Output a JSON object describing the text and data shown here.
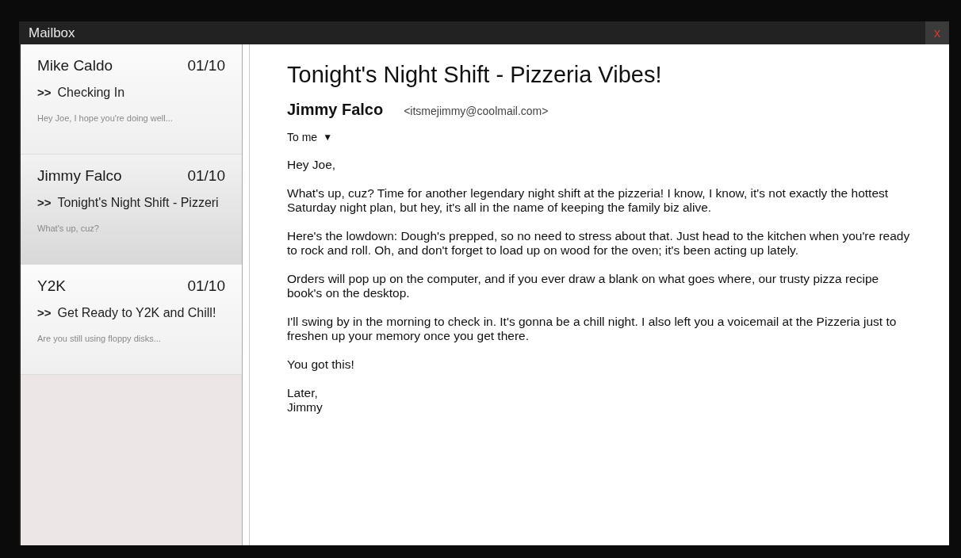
{
  "window": {
    "title": "Mailbox",
    "close": "x"
  },
  "messages": [
    {
      "sender": "Mike Caldo",
      "date": "01/10",
      "marker": ">>",
      "subject": "Checking In",
      "preview": "Hey Joe, I hope you're doing well...",
      "selected": false
    },
    {
      "sender": "Jimmy Falco",
      "date": "01/10",
      "marker": ">>",
      "subject": "Tonight's Night Shift - Pizzeri",
      "preview": "What's up, cuz?",
      "selected": true
    },
    {
      "sender": "Y2K",
      "date": "01/10",
      "marker": ">>",
      "subject": "Get Ready to Y2K and Chill!",
      "preview": "Are you still using floppy disks...",
      "selected": false
    }
  ],
  "email": {
    "subject": "Tonight's Night Shift - Pizzeria Vibes!",
    "sender": "Jimmy Falco",
    "address": "<itsmejimmy@coolmail.com>",
    "recipient": "To me",
    "recipient_caret": "▼",
    "paragraphs": [
      "Hey Joe,",
      "What's up, cuz? Time for another legendary night shift at the pizzeria! I know, I know, it's not exactly the hottest Saturday night plan, but hey, it's all in the name of keeping the family biz alive.",
      "Here's the lowdown: Dough's prepped, so no need to stress about that. Just head to the kitchen when you're ready to rock and roll. Oh, and don't forget to load up on wood for the oven; it's been acting up lately.",
      "Orders will pop up on the computer, and if you ever draw a blank on what goes where, our trusty pizza recipe book's on the desktop.",
      "I'll swing by in the morning to check in. It's gonna be a chill night. I also left you a voicemail at the Pizzeria just to freshen up your memory once you get there.",
      "You got this!",
      "Later,\nJimmy"
    ]
  }
}
